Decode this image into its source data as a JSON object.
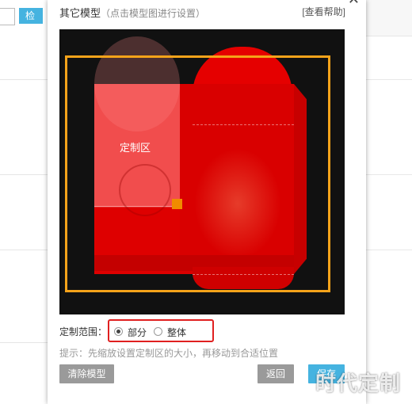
{
  "background": {
    "button_label": "检"
  },
  "modal": {
    "title": "其它模型",
    "subtitle": "（点击模型图进行设置）",
    "help_link": "[查看帮助]",
    "close": "✕",
    "canvas": {
      "custom_zone_label": "定制区"
    },
    "range": {
      "label": "定制范围：",
      "options": [
        {
          "label": "部分",
          "selected": true
        },
        {
          "label": "整体",
          "selected": false
        }
      ]
    },
    "tip": "提示：先缩放设置定制区的大小，再移动到合适位置",
    "buttons": {
      "clear": "清除模型",
      "back": "返回",
      "save": "保存"
    }
  },
  "watermark": "时代定制",
  "colors": {
    "accent_blue": "#45b3e0",
    "frame_orange": "#f5a31a",
    "highlight_red": "#e02020",
    "envelope_red": "#d90000"
  }
}
